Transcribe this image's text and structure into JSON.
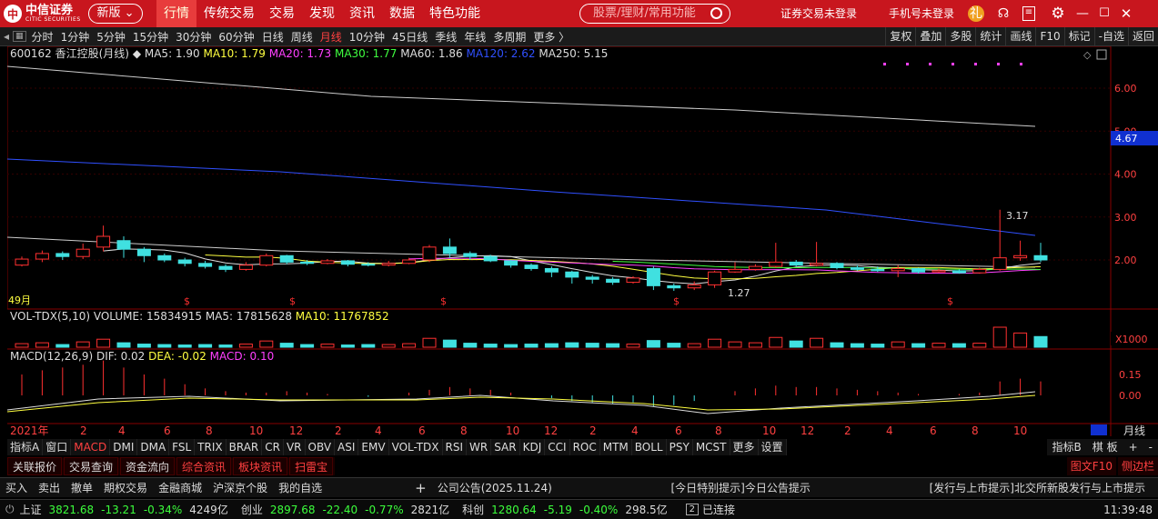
{
  "brand": {
    "name": "中信证券",
    "sub": "CITIC SECURITIES"
  },
  "version_label": "新版",
  "nav": [
    "行情",
    "传统交易",
    "交易",
    "发现",
    "资讯",
    "数据",
    "特色功能"
  ],
  "search_placeholder": "股票/理财/常用功能",
  "account": {
    "trade_status": "证券交易未登录",
    "phone_status": "手机号未登录"
  },
  "periods": [
    "分时",
    "1分钟",
    "5分钟",
    "15分钟",
    "30分钟",
    "60分钟",
    "日线",
    "周线",
    "月线",
    "10分钟",
    "45日线",
    "季线",
    "年线",
    "多周期",
    "更多 〉"
  ],
  "active_period": "月线",
  "right_tools": [
    "复权",
    "叠加",
    "多股",
    "统计",
    "画线",
    "F10",
    "标记",
    "-自选",
    "返回"
  ],
  "chart_data": {
    "type": "candlestick",
    "stock": "600162 香江控股(月线)",
    "ma": [
      {
        "name": "MA5",
        "value": "1.90",
        "color": "#dddddd"
      },
      {
        "name": "MA10",
        "value": "1.79",
        "color": "#ffff40"
      },
      {
        "name": "MA20",
        "value": "1.73",
        "color": "#ff40ff"
      },
      {
        "name": "MA30",
        "value": "1.77",
        "color": "#40ff40"
      },
      {
        "name": "MA60",
        "value": "1.86",
        "color": "#dddddd"
      },
      {
        "name": "MA120",
        "value": "2.62",
        "color": "#3050ff"
      },
      {
        "name": "MA250",
        "value": "5.15",
        "color": "#dddddd"
      }
    ],
    "y_ticks": [
      "6.00",
      "5.00",
      "4.00",
      "3.00",
      "2.00"
    ],
    "price_tag": "4.67",
    "high_label": "3.17",
    "low_label": "1.27",
    "period_count": "49月",
    "volume": {
      "title": "VOL-TDX(5,10)",
      "volume": "15834915",
      "ma5": "17815628",
      "ma10": "11767852",
      "unit": "X1000"
    },
    "macd": {
      "title": "MACD(12,26,9)",
      "dif": "0.02",
      "dea": "-0.02",
      "macd": "0.10",
      "ticks": [
        "0.15",
        "0.00"
      ]
    },
    "x_labels": [
      "2021年",
      "2",
      "4",
      "6",
      "8",
      "10",
      "12",
      "2",
      "4",
      "6",
      "8",
      "10",
      "12",
      "2",
      "4",
      "6",
      "8",
      "10",
      "12",
      "2",
      "4",
      "6",
      "8",
      "10"
    ],
    "right_label": "月线",
    "candles": [
      [
        1.88,
        2.02,
        2.08,
        1.85
      ],
      [
        2.02,
        2.15,
        2.22,
        1.95
      ],
      [
        2.15,
        2.08,
        2.2,
        2.0
      ],
      [
        2.08,
        2.25,
        2.38,
        2.02
      ],
      [
        2.3,
        2.55,
        2.8,
        2.2
      ],
      [
        2.45,
        2.25,
        2.55,
        2.05
      ],
      [
        2.25,
        2.1,
        2.3,
        1.95
      ],
      [
        2.1,
        2.0,
        2.15,
        1.95
      ],
      [
        2.0,
        1.92,
        2.05,
        1.85
      ],
      [
        1.92,
        1.85,
        1.98,
        1.8
      ],
      [
        1.85,
        1.78,
        1.9,
        1.72
      ],
      [
        1.78,
        1.88,
        1.95,
        1.75
      ],
      [
        1.88,
        2.1,
        2.15,
        1.85
      ],
      [
        2.1,
        1.95,
        2.12,
        1.9
      ],
      [
        1.95,
        1.92,
        2.0,
        1.88
      ],
      [
        1.92,
        1.98,
        2.02,
        1.9
      ],
      [
        1.98,
        1.9,
        2.0,
        1.85
      ],
      [
        1.9,
        1.88,
        1.95,
        1.85
      ],
      [
        1.88,
        1.92,
        1.98,
        1.85
      ],
      [
        1.92,
        2.0,
        2.05,
        1.9
      ],
      [
        2.0,
        2.3,
        2.35,
        1.95
      ],
      [
        2.3,
        2.15,
        2.5,
        2.05
      ],
      [
        2.15,
        2.08,
        2.2,
        2.0
      ],
      [
        2.08,
        1.98,
        2.12,
        1.95
      ],
      [
        1.98,
        1.88,
        2.0,
        1.82
      ],
      [
        1.88,
        1.8,
        1.92,
        1.75
      ],
      [
        1.8,
        1.72,
        1.85,
        1.6
      ],
      [
        1.72,
        1.6,
        1.75,
        1.45
      ],
      [
        1.6,
        1.55,
        1.65,
        1.45
      ],
      [
        1.55,
        1.48,
        1.6,
        1.42
      ],
      [
        1.48,
        1.58,
        1.62,
        1.45
      ],
      [
        1.8,
        1.4,
        1.85,
        1.3
      ],
      [
        1.4,
        1.35,
        1.45,
        1.28
      ],
      [
        1.35,
        1.42,
        1.5,
        1.3
      ],
      [
        1.42,
        1.72,
        1.75,
        1.35
      ],
      [
        1.72,
        1.78,
        1.95,
        1.7
      ],
      [
        1.78,
        1.85,
        1.9,
        1.75
      ],
      [
        1.85,
        1.95,
        2.4,
        1.82
      ],
      [
        1.95,
        1.88,
        2.0,
        1.85
      ],
      [
        1.88,
        1.92,
        2.42,
        1.85
      ],
      [
        1.92,
        1.82,
        1.95,
        1.78
      ],
      [
        1.82,
        1.78,
        1.88,
        1.75
      ],
      [
        1.78,
        1.75,
        1.85,
        1.72
      ],
      [
        1.75,
        1.8,
        1.88,
        1.6
      ],
      [
        1.8,
        1.72,
        1.82,
        1.68
      ],
      [
        1.72,
        1.75,
        1.8,
        1.7
      ],
      [
        1.75,
        1.7,
        1.78,
        1.68
      ],
      [
        1.7,
        1.78,
        1.82,
        1.68
      ],
      [
        1.78,
        2.05,
        3.17,
        1.75
      ],
      [
        2.05,
        2.1,
        2.45,
        1.98
      ],
      [
        2.1,
        2.0,
        2.4,
        1.95
      ]
    ],
    "vol": [
      8,
      10,
      6,
      12,
      18,
      10,
      7,
      6,
      5,
      6,
      5,
      7,
      14,
      9,
      6,
      7,
      5,
      6,
      6,
      8,
      20,
      16,
      9,
      7,
      6,
      7,
      8,
      10,
      9,
      8,
      7,
      15,
      9,
      8,
      18,
      12,
      10,
      22,
      14,
      20,
      10,
      8,
      7,
      12,
      8,
      9,
      8,
      9,
      45,
      32,
      24
    ],
    "macd_bars": [
      0.15,
      0.18,
      0.2,
      0.22,
      0.25,
      0.2,
      0.15,
      0.12,
      0.08,
      0.05,
      0.03,
      0.02,
      0.02,
      0.03,
      0.02,
      0.01,
      0.0,
      -0.01,
      0.0,
      0.02,
      0.04,
      0.06,
      0.05,
      0.04,
      0.02,
      0.0,
      -0.02,
      -0.04,
      -0.05,
      -0.06,
      -0.05,
      -0.08,
      -0.07,
      -0.04,
      0.0,
      0.03,
      0.05,
      0.07,
      0.06,
      0.06,
      0.05,
      0.04,
      0.03,
      0.02,
      0.01,
      0.0,
      0.01,
      0.02,
      0.1,
      0.12,
      0.1
    ]
  },
  "indicator_tabs": [
    "指标A",
    "窗口",
    "MACD",
    "DMI",
    "DMA",
    "FSL",
    "TRIX",
    "BRAR",
    "CR",
    "VR",
    "OBV",
    "ASI",
    "EMV",
    "VOL-TDX",
    "RSI",
    "WR",
    "SAR",
    "KDJ",
    "CCI",
    "ROC",
    "MTM",
    "BOLL",
    "PSY",
    "MCST",
    "更多",
    "设置"
  ],
  "indicator_right": [
    "指标B",
    "棋 板",
    "+",
    "-"
  ],
  "bottom_tabs": [
    "关联报价",
    "交易查询",
    "资金流向",
    "综合资讯",
    "板块资讯",
    "扫雷宝"
  ],
  "bottom_right": [
    "图文F10",
    "侧边栏"
  ],
  "toolbar2": [
    "买入",
    "卖出",
    "撤单",
    "期权交易",
    "金融商城",
    "沪深京个股",
    "我的自选"
  ],
  "notices": [
    "公司公告(2025.11.24)",
    "[今日特别提示]今日公告提示",
    "[发行与上市提示]北交所新股发行与上市提示"
  ],
  "ticker": [
    {
      "name": "上证",
      "value": "3821.68",
      "change": "-13.21",
      "pct": "-0.34%",
      "amount": "4249亿"
    },
    {
      "name": "创业",
      "value": "2897.68",
      "change": "-22.40",
      "pct": "-0.77%",
      "amount": "2821亿"
    },
    {
      "name": "科创",
      "value": "1280.64",
      "change": "-5.19",
      "pct": "-0.40%",
      "amount": "298.5亿"
    }
  ],
  "connection": "已连接",
  "connection_count": "2",
  "time": "11:39:48"
}
